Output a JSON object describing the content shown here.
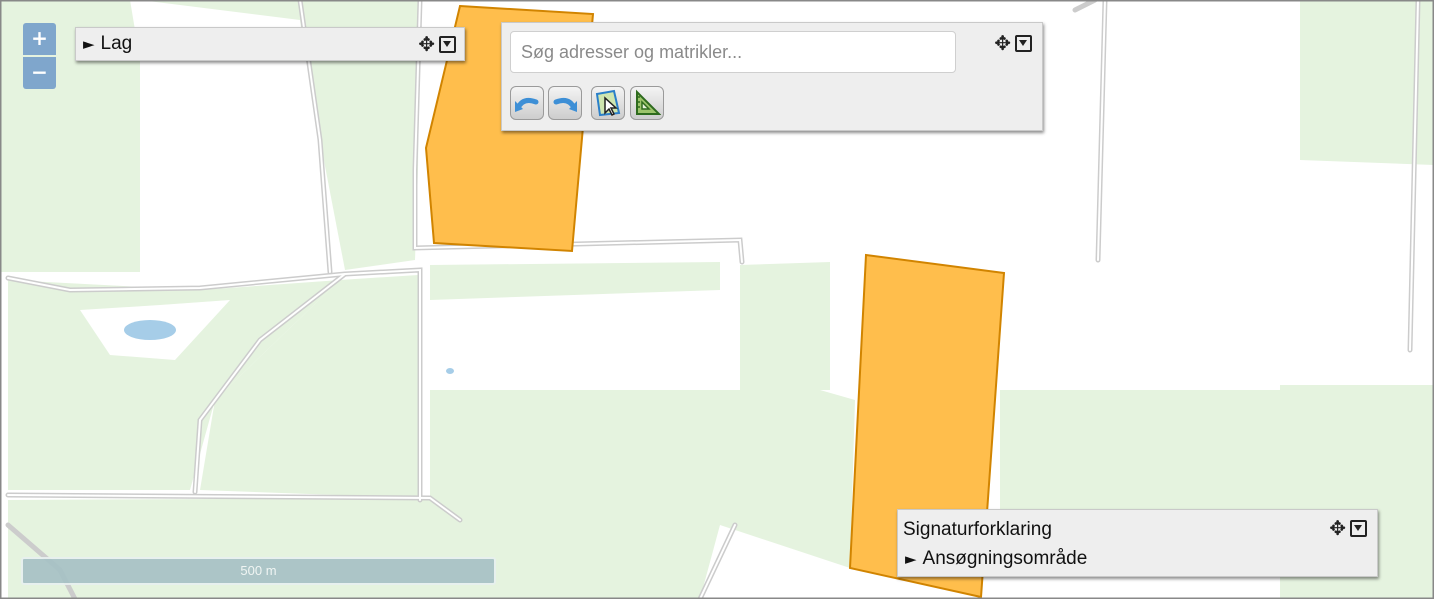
{
  "map": {
    "colors": {
      "background": "#ffffff",
      "field": "#e5f3df",
      "road": "#cfcfcf",
      "water": "#a6cde8",
      "area_fill": "#ffbe4c",
      "area_stroke": "#d18400"
    }
  },
  "zoom": {
    "in_label": "+",
    "out_label": "−"
  },
  "layers_panel": {
    "toggle": "►",
    "title": "Lag",
    "move_icon": "move-icon",
    "collapse_icon": "collapse-icon"
  },
  "search_panel": {
    "placeholder": "Søg adresser og matrikler...",
    "value": "",
    "tools": [
      {
        "name": "undo-icon"
      },
      {
        "name": "redo-icon"
      },
      {
        "name": "select-area-icon"
      },
      {
        "name": "measure-icon"
      }
    ]
  },
  "legend": {
    "title": "Signaturforklaring",
    "toggle": "►",
    "item": "Ansøgningsområde"
  },
  "scale_bar": {
    "label": "500 m"
  }
}
